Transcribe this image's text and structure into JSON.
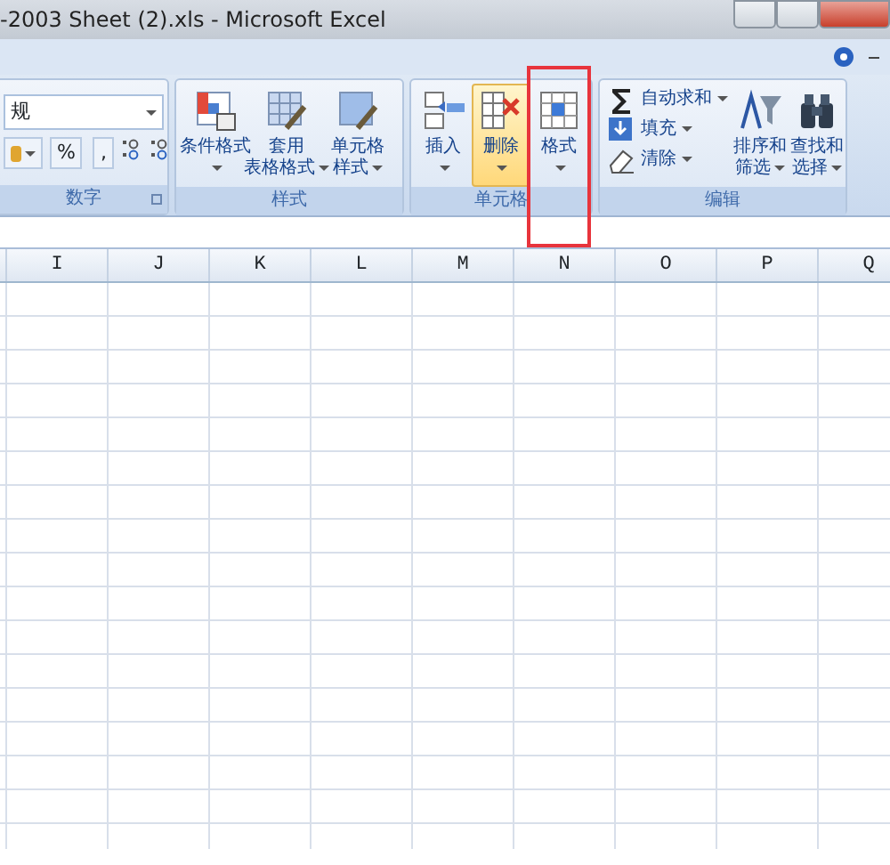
{
  "window": {
    "title": "-2003 Sheet (2).xls - Microsoft Excel"
  },
  "ribbon": {
    "groups": [
      {
        "label": "数字",
        "kind": "number",
        "format_value": "规",
        "buttons": [
          "%",
          ","
        ]
      },
      {
        "label": "样式",
        "kind": "large",
        "items": [
          {
            "lines": [
              "条件格式"
            ],
            "hovered": false,
            "highlighted": false
          },
          {
            "lines": [
              "套用",
              "表格格式"
            ],
            "hovered": false,
            "highlighted": false
          },
          {
            "lines": [
              "单元格",
              "样式"
            ],
            "hovered": false,
            "highlighted": false
          }
        ]
      },
      {
        "label": "单元格",
        "kind": "large",
        "items": [
          {
            "lines": [
              "插入"
            ],
            "hovered": false,
            "highlighted": false
          },
          {
            "lines": [
              "删除"
            ],
            "hovered": true,
            "highlighted": false
          },
          {
            "lines": [
              "格式"
            ],
            "hovered": false,
            "highlighted": true
          }
        ]
      },
      {
        "label": "编辑",
        "kind": "editing",
        "small": [
          {
            "label": "自动求和"
          },
          {
            "label": "填充"
          },
          {
            "label": "清除"
          }
        ],
        "items": [
          {
            "lines": [
              "排序和",
              "筛选"
            ],
            "hovered": false,
            "highlighted": false
          },
          {
            "lines": [
              "查找和",
              "选择"
            ],
            "hovered": false,
            "highlighted": false
          }
        ]
      }
    ]
  },
  "sheet": {
    "columns": [
      "I",
      "J",
      "K",
      "L",
      "M",
      "N",
      "O",
      "P",
      "Q"
    ]
  }
}
